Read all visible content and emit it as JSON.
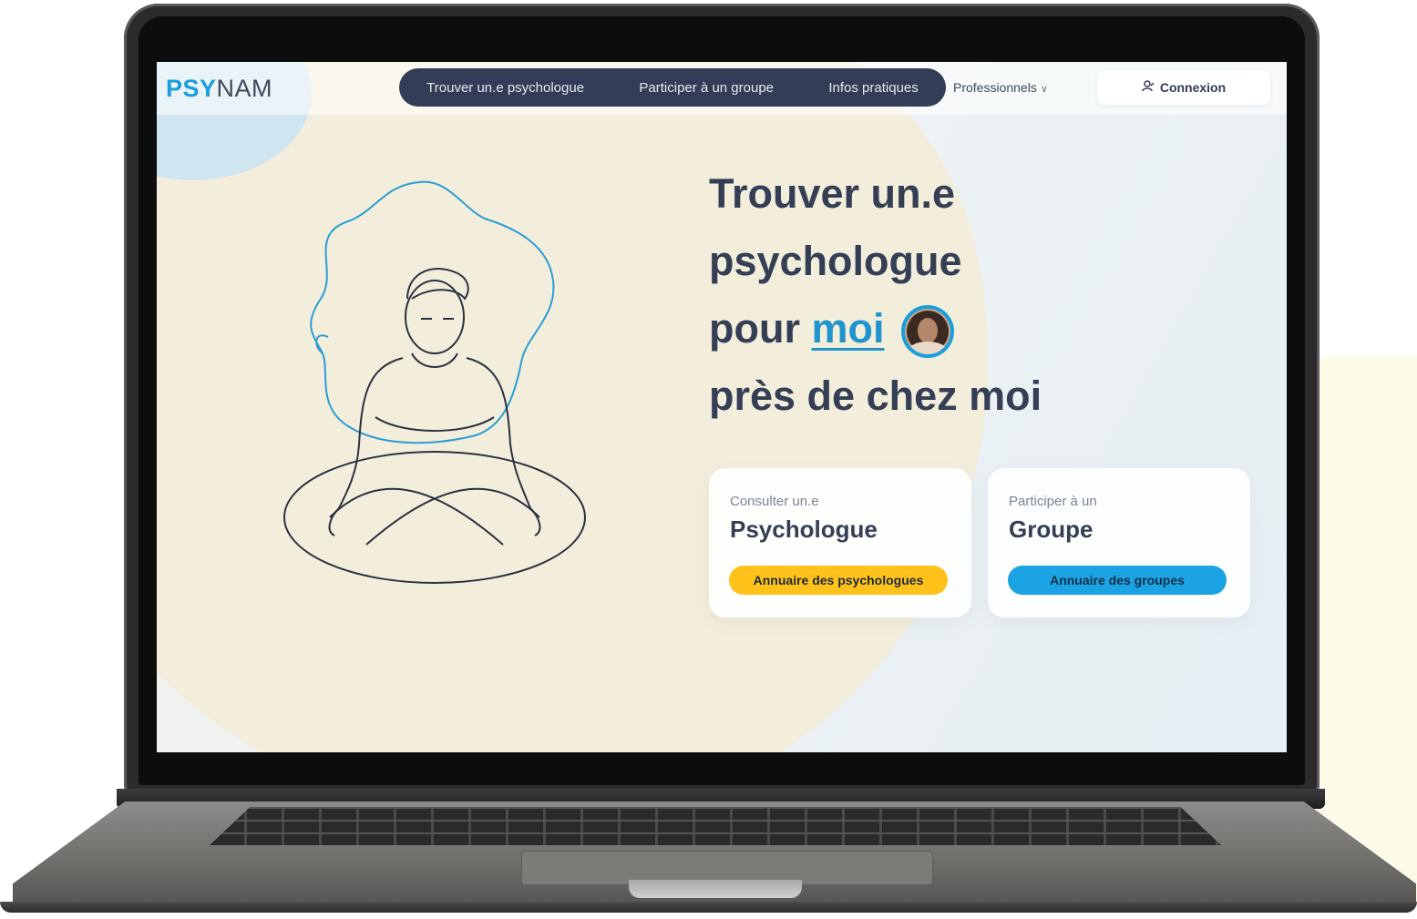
{
  "nav": {
    "logo_bold": "PSY",
    "logo_light": "NAM",
    "links": [
      "Trouver un.e psychologue",
      "Participer à un groupe",
      "Infos pratiques"
    ],
    "pro_label": "Professionnels",
    "login_label": "Connexion"
  },
  "hero": {
    "line1": "Trouver un.e",
    "line2": "psychologue",
    "line3_prefix": "pour",
    "line3_highlight": "moi",
    "line4": "près de chez moi"
  },
  "cards": [
    {
      "small": "Consulter un.e",
      "title": "Psychologue",
      "button": "Annuaire des psychologues",
      "button_color": "#ffc21a"
    },
    {
      "small": "Participer à un",
      "title": "Groupe",
      "button": "Annuaire des groupes",
      "button_color": "#1ba3e3"
    }
  ],
  "colors": {
    "brand_blue": "#1a9fdc",
    "nav_dark": "#333d57",
    "text_dark": "#343f55"
  }
}
